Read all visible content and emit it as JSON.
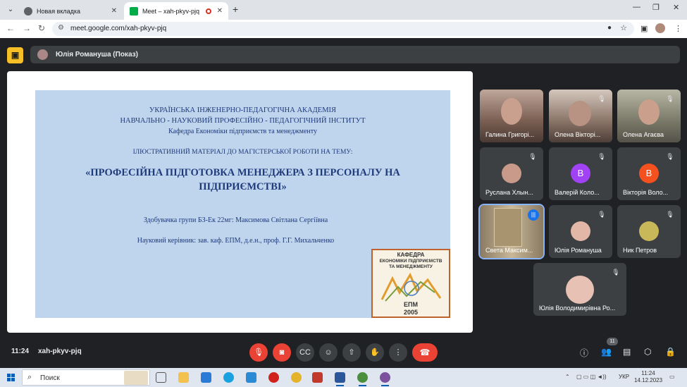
{
  "browser": {
    "tabs": [
      {
        "title": "Новая вкладка",
        "active": false
      },
      {
        "title": "Meet – xah-pkyv-pjq",
        "active": true
      }
    ],
    "url": "meet.google.com/xah-pkyv-pjq"
  },
  "meet": {
    "presenter_label": "Юлія Романуша (Показ)",
    "time": "11:24",
    "meeting_code": "xah-pkyv-pjq",
    "participant_count": "11"
  },
  "slide": {
    "line1": "УКРАЇНСЬКА ІНЖЕНЕРНО-ПЕДАГОГІЧНА АКАДЕМІЯ",
    "line2": "НАВЧАЛЬНО - НАУКОВИЙ ПРОФЕСІЙНО - ПЕДАГОГІЧНИЙ ІНСТИТУТ",
    "line3": "Кафедра Економіки підприємств та менеджменту",
    "line4": "ІЛЮСТРАТИВНИЙ МАТЕРІАЛ  ДО МАГІСТЕРСЬКОЇ  РОБОТИ НА ТЕМУ:",
    "title_line1": "«ПРОФЕСІЙНА ПІДГОТОВКА МЕНЕДЖЕРА З ПЕРСОНАЛУ НА",
    "title_line2": "ПІДПРИЄМСТВІ»",
    "student": "Здобувачка групи БЗ-Ек 22мг:  Максимова Світлана Сергіївна",
    "advisor": "Науковий керівник:  зав. каф. ЕПМ, д.е.н., проф. Г.Г. Михальченко",
    "logo": {
      "l1": "КАФЕДРА",
      "l2": "ЕКОНОМІКИ ПІДПРИЄМСТВ",
      "l3": "ТА МЕНЕДЖМЕНТУ",
      "l4": "ЕПМ",
      "l5": "2005"
    }
  },
  "participants": [
    {
      "name": "Галина Григорі...",
      "type": "video",
      "color": "#7a6a64"
    },
    {
      "name": "Олена Вікторі...",
      "type": "video",
      "color": "#6f5d55"
    },
    {
      "name": "Олена Агаєва",
      "type": "video",
      "color": "#8a8a7a"
    },
    {
      "name": "Руслана Хлын...",
      "type": "photo",
      "color": "#c99a8a"
    },
    {
      "name": "Валерій Коло...",
      "type": "letter",
      "letter": "В",
      "color": "#a142f4"
    },
    {
      "name": "Вікторія Воло...",
      "type": "letter",
      "letter": "В",
      "color": "#f4511e"
    },
    {
      "name": "Света Максим...",
      "type": "video",
      "color": "#8c7a62"
    },
    {
      "name": "Юлія Романуша",
      "type": "photo",
      "color": "#e3b7a7"
    },
    {
      "name": "Ник Петров",
      "type": "photo",
      "color": "#c8b85a"
    },
    {
      "name": "Юлія Володимирівна Ро...",
      "type": "photo",
      "color": "#e7c2b4"
    }
  ],
  "taskbar": {
    "search_label": "Поиск",
    "lang": "УКР",
    "time": "11:24",
    "date": "14.12.2023"
  }
}
